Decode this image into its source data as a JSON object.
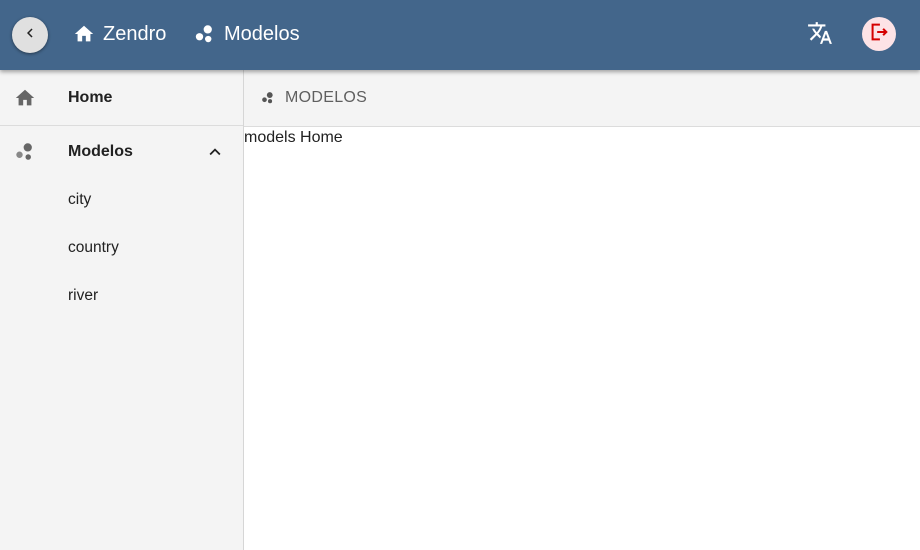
{
  "header": {
    "home_label": "Zendro",
    "models_label": "Modelos",
    "colors": {
      "bar": "#43668b",
      "logout": "#d50000"
    },
    "icons": {
      "back": "chevron-left-icon",
      "home": "home-icon",
      "models": "bubbles-icon",
      "translate": "translate-icon",
      "logout": "logout-icon"
    }
  },
  "sidebar": {
    "home_label": "Home",
    "models_label": "Modelos",
    "models_expanded": true,
    "models": [
      {
        "label": "city"
      },
      {
        "label": "country"
      },
      {
        "label": "river"
      }
    ]
  },
  "subbar": {
    "label": "MODELOS"
  },
  "main": {
    "text": "models Home"
  }
}
